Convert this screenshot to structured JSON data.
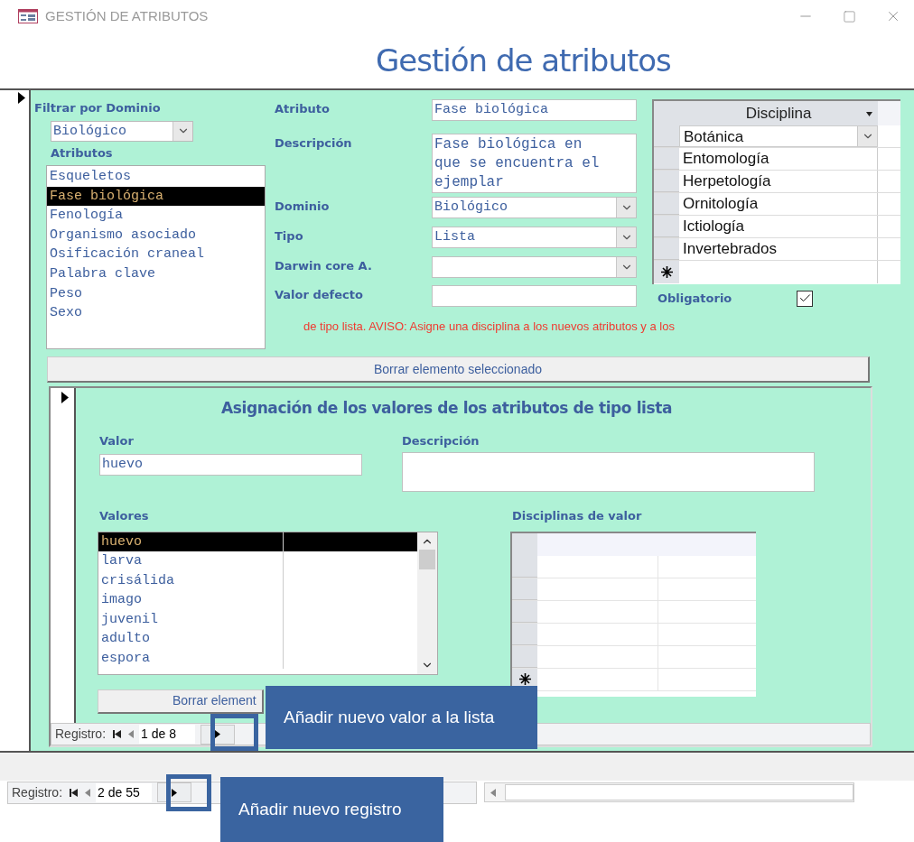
{
  "window": {
    "title": "GESTIÓN DE ATRIBUTOS"
  },
  "form_title": "Gestión de atributos",
  "filter": {
    "label": "Filtrar por Dominio",
    "value": "Biológico"
  },
  "attributes": {
    "label": "Atributos",
    "items": [
      {
        "text": "Esqueletos",
        "selected": false
      },
      {
        "text": "Fase biológica",
        "selected": true
      },
      {
        "text": "Fenología",
        "selected": false
      },
      {
        "text": "Organismo asociado",
        "selected": false
      },
      {
        "text": "Osificación craneal",
        "selected": false
      },
      {
        "text": "Palabra clave",
        "selected": false
      },
      {
        "text": "Peso",
        "selected": false
      },
      {
        "text": "Sexo",
        "selected": false
      }
    ]
  },
  "fields": [
    {
      "kind": "text",
      "label": "Atributo",
      "value": "Fase biológica"
    },
    {
      "kind": "textarea",
      "label": "Descripción",
      "value": "Fase biológica en que se encuentra el ejemplar"
    },
    {
      "kind": "combo",
      "label": "Dominio",
      "value": "Biológico"
    },
    {
      "kind": "combo",
      "label": "Tipo",
      "value": "Lista"
    },
    {
      "kind": "combo",
      "label": "Darwin core A."
    },
    {
      "kind": "text",
      "label": "Valor defecto"
    }
  ],
  "warning": "de tipo lista. AVISO: Asigne una disciplina a los nuevos atributos y a los",
  "disciplines": {
    "column": "Disciplina",
    "rows": [
      {
        "text": "Botánica",
        "selected": true
      },
      {
        "text": "Entomología",
        "selected": false
      },
      {
        "text": "Herpetología",
        "selected": false
      },
      {
        "text": "Ornitología",
        "selected": false
      },
      {
        "text": "Ictiología",
        "selected": false
      },
      {
        "text": "Invertebrados",
        "selected": false
      }
    ]
  },
  "mandatory": {
    "label": "Obligatorio",
    "checked": true
  },
  "delete_button": "Borrar elemento seleccionado",
  "subform": {
    "title": "Asignación de los valores de los atributos de tipo lista",
    "value": {
      "label": "Valor",
      "value": "huevo"
    },
    "description": {
      "label": "Descripción"
    },
    "values": {
      "label": "Valores",
      "items": [
        {
          "text": "huevo",
          "selected": true
        },
        {
          "text": "larva",
          "selected": false
        },
        {
          "text": "crisálida",
          "selected": false
        },
        {
          "text": "imago",
          "selected": false
        },
        {
          "text": "juvenil",
          "selected": false
        },
        {
          "text": "adulto",
          "selected": false
        },
        {
          "text": "espora",
          "selected": false
        }
      ]
    },
    "value_disciplines": {
      "label": "Disciplinas de valor"
    },
    "delete_button": "Borrar element",
    "navigation": {
      "label": "Registro:",
      "position": "1 de 8"
    }
  },
  "navigation": {
    "label": "Registro:",
    "position": "2 de 55"
  },
  "callouts": [
    {
      "text": "Añadir nuevo valor a la lista"
    },
    {
      "text": "Añadir nuevo registro"
    }
  ]
}
